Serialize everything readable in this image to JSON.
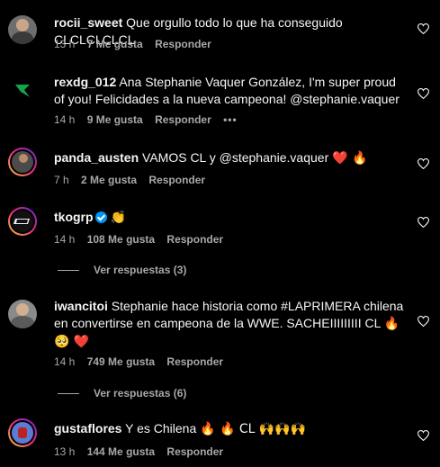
{
  "colors": {
    "background": "#000000",
    "text": "#f5f5f5",
    "muted": "#a8a8a8",
    "verified": "#0095f6"
  },
  "comments": [
    {
      "username": "rocii_sweet",
      "text": "Que orgullo todo lo que ha conseguido CLCLCLCLCL",
      "time": "13 h",
      "likes": "7 Me gusta",
      "reply": "Responder"
    },
    {
      "username": "rexdg_012",
      "text": "Ana Stephanie Vaquer González, I'm super proud of you! Felicidades a la nueva campeona! @stephanie.vaquer",
      "time": "14 h",
      "likes": "9 Me gusta",
      "reply": "Responder",
      "more": "•••"
    },
    {
      "username": "panda_austen",
      "text": "VAMOS CL y @stephanie.vaquer",
      "emojis": "❤️ 🔥",
      "time": "7 h",
      "likes": "2 Me gusta",
      "reply": "Responder"
    },
    {
      "username": "tkogrp",
      "verified_icon": "verified-badge-icon",
      "emojis": "👏",
      "time": "14 h",
      "likes": "108 Me gusta",
      "reply": "Responder",
      "view_replies": "Ver respuestas (3)"
    },
    {
      "username": "iwancitoi",
      "text": "Stephanie hace historia como #LAPRIMERA chilena en convertirse en campeona de la WWE. SACHEIIIIIIIII CL",
      "emojis": "🔥 🥺 ❤️",
      "time": "14 h",
      "likes": "749 Me gusta",
      "reply": "Responder",
      "view_replies": "Ver respuestas (6)"
    },
    {
      "username": "gustaflores",
      "text": "Y es Chilena",
      "emojis": "🔥 🔥 CL 🙌🙌🙌",
      "time": "13 h",
      "likes": "144 Me gusta",
      "reply": "Responder"
    }
  ]
}
